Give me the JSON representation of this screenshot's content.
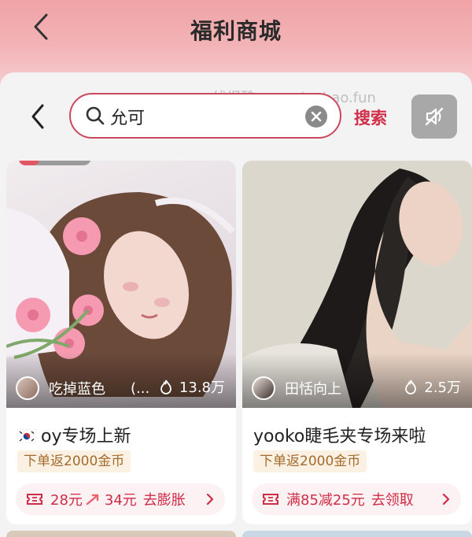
{
  "header": {
    "title": "福利商城"
  },
  "search": {
    "value": "允可",
    "submit_label": "搜索",
    "watermark": "线报酷-new.xianbao.fun"
  },
  "products": [
    {
      "creator": "吃掉蓝色",
      "creator_suffix": "(...",
      "likes": "13.8万",
      "name": "oy专场上新",
      "flag": "korea-flag-icon",
      "coin_tag": "下单返2000金币",
      "deal": {
        "from": "28元",
        "to": "34元",
        "action": "去膨胀"
      }
    },
    {
      "creator": "田恬向上",
      "likes": "2.5万",
      "name": "yooko睫毛夹专场来啦",
      "coin_tag": "下单返2000金币",
      "deal": {
        "text": "满85减25元",
        "action": "去领取"
      }
    }
  ],
  "colors": {
    "accent": "#d0304a",
    "coin_text": "#a46b2e",
    "header_bg": "#efa3a5"
  }
}
